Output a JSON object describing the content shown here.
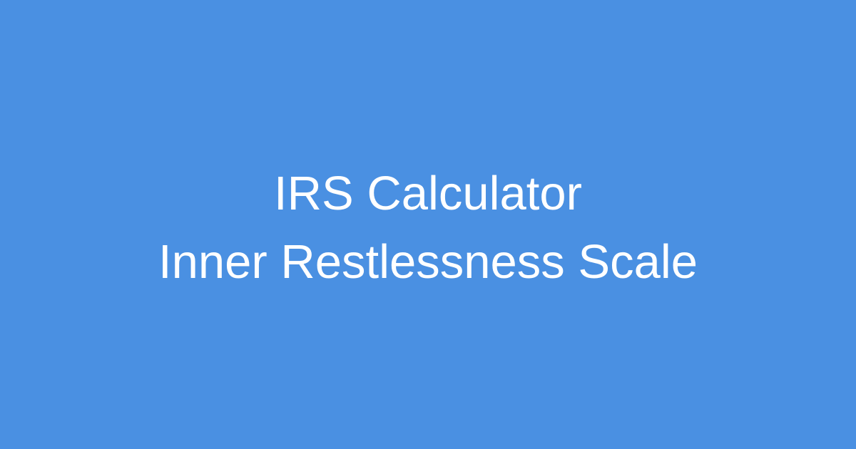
{
  "card": {
    "background_color": "#4a90e2",
    "text_color": "#ffffff",
    "title_line_1": "IRS Calculator",
    "title_line_2": "Inner Restlessness Scale"
  }
}
